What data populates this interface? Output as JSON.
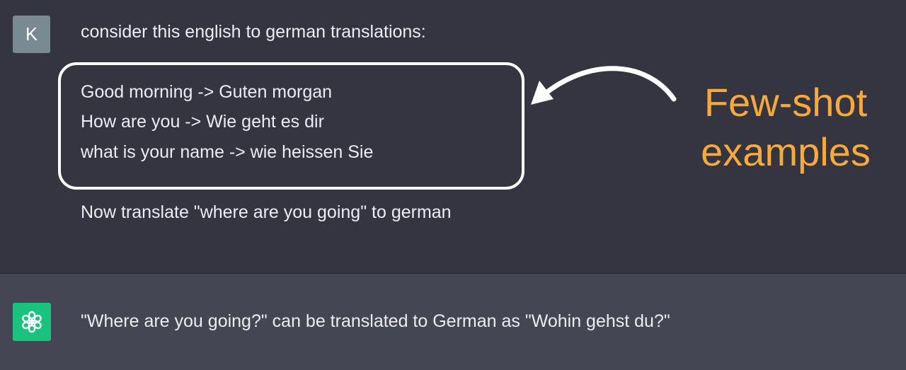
{
  "conversation": {
    "user_message": {
      "avatar_initial": "K",
      "intro": "consider this english to german translations:",
      "examples": [
        "Good morning -> Guten morgan",
        "How are you -> Wie geht es dir",
        "what is your name -> wie heissen Sie"
      ],
      "instruction": "Now translate \"where are you going\" to german"
    },
    "assistant_message": {
      "avatar_icon": "openai-logo-icon",
      "text": "\"Where are you going?\" can be translated to German as \"Wohin gehst du?\""
    }
  },
  "annotation": {
    "line1": "Few-shot",
    "line2": "examples",
    "color": "#f7a93b"
  },
  "colors": {
    "user_bg": "#343541",
    "assistant_bg": "#444654",
    "user_avatar": "#7a8a93",
    "assistant_avatar": "#19c37d",
    "text": "#ececf1"
  }
}
